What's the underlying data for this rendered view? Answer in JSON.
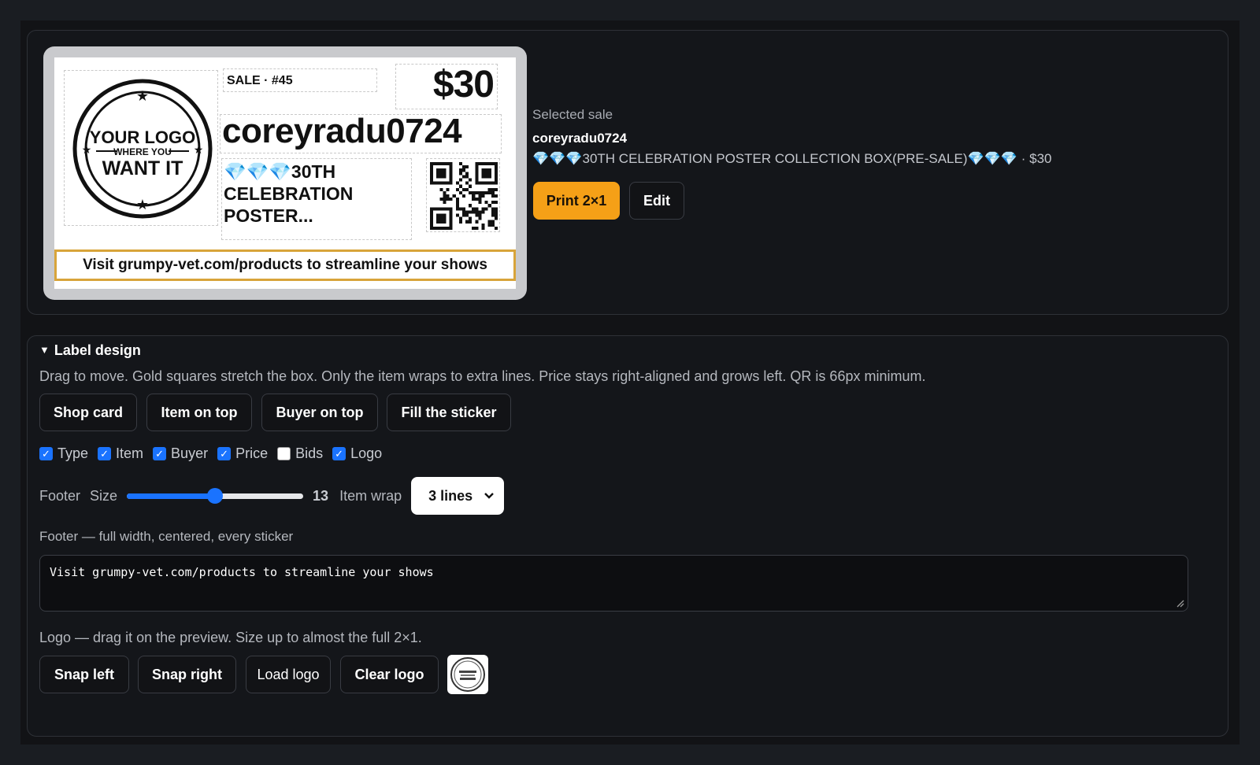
{
  "preview": {
    "sale_tag": "SALE · #45",
    "price": "$30",
    "buyer": "coreyradu0724",
    "item": "💎💎💎30TH CELEBRATION POSTER...",
    "footer": "Visit grumpy-vet.com/products to streamline your shows",
    "logo": {
      "line1": "YOUR LOGO",
      "line2": "WHERE YOU",
      "line3": "WANT IT"
    }
  },
  "selected": {
    "label": "Selected sale",
    "buyer": "coreyradu0724",
    "summary": "💎💎💎30TH CELEBRATION POSTER COLLECTION BOX(PRE-SALE)💎💎💎 · $30",
    "print_label": "Print 2×1",
    "edit_label": "Edit"
  },
  "design": {
    "title": "Label design",
    "hint": "Drag to move. Gold squares stretch the box. Only the item wraps to extra lines. Price stays right-aligned and grows left. QR is 66px minimum.",
    "presets": [
      "Shop card",
      "Item on top",
      "Buyer on top",
      "Fill the sticker"
    ],
    "fields": [
      {
        "label": "Type",
        "checked": true
      },
      {
        "label": "Item",
        "checked": true
      },
      {
        "label": "Buyer",
        "checked": true
      },
      {
        "label": "Price",
        "checked": true
      },
      {
        "label": "Bids",
        "checked": false
      },
      {
        "label": "Logo",
        "checked": true
      }
    ],
    "footer_label": "Footer",
    "size_label": "Size",
    "size_value": "13",
    "size_fraction": 0.5,
    "wrap_label": "Item wrap",
    "wrap_value": "3 lines",
    "footer_hint": "Footer — full width, centered, every sticker",
    "footer_text": "Visit grumpy-vet.com/products to streamline your shows",
    "logo_hint": "Logo — drag it on the preview. Size up to almost the full 2×1.",
    "logo_buttons": [
      "Snap left",
      "Snap right",
      "Load logo",
      "Clear logo"
    ]
  },
  "colors": {
    "accent": "#f5a017",
    "checkbox": "#1a73ff",
    "footer_border": "#d8a43a"
  }
}
